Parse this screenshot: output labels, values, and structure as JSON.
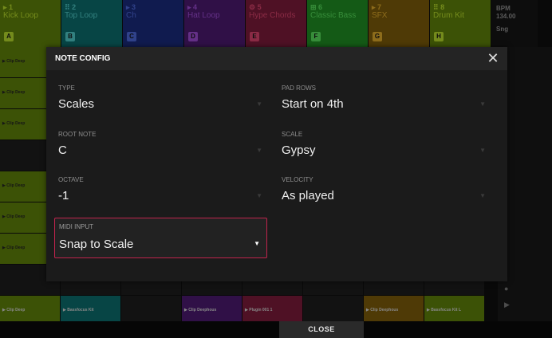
{
  "tracks": [
    {
      "num": "▸ 1",
      "name": "Kick Loop",
      "badge": "A",
      "bg": "#5d7f0a",
      "fg": "#b3d62b"
    },
    {
      "num": "⠿ 2",
      "name": "Top Loop",
      "badge": "B",
      "bg": "#0b6b6a",
      "fg": "#4ec5c3"
    },
    {
      "num": "▸ 3",
      "name": "Ch",
      "badge": "C",
      "bg": "#1a2a7a",
      "fg": "#4b66d4"
    },
    {
      "num": "▸ 4",
      "name": "Hat Loop",
      "badge": "D",
      "bg": "#4a1a6e",
      "fg": "#9a4ad0"
    },
    {
      "num": "⚙ 5",
      "name": "Hype Chords",
      "badge": "E",
      "bg": "#7a1b3a",
      "fg": "#d4436a"
    },
    {
      "num": "⊞ 6",
      "name": "Classic Bass",
      "badge": "F",
      "bg": "#1f8a22",
      "fg": "#55d95a"
    },
    {
      "num": "▸ 7",
      "name": "SFX",
      "badge": "G",
      "bg": "#7a5a0a",
      "fg": "#d9a62a"
    },
    {
      "num": "⠿ 8",
      "name": "Drum Kit",
      "badge": "H",
      "bg": "#5d7f0a",
      "fg": "#b3d62b"
    }
  ],
  "bpm": {
    "label": "BPM",
    "value": "134.00",
    "extra": "Sng"
  },
  "clip_label": "▶ Clip Deep",
  "bottom_clips": [
    "▶ Clip Deep",
    "▶ Bassfocus Kit",
    "",
    "▶ Clip Deephous",
    "▶ Plugin 001 1",
    "",
    "▶ Clip Deephous",
    "▶ Bassfocus Kit L"
  ],
  "modal": {
    "title": "NOTE CONFIG",
    "close_icon": "✕",
    "fields": {
      "type": {
        "label": "TYPE",
        "value": "Scales"
      },
      "pad_rows": {
        "label": "PAD ROWS",
        "value": "Start on 4th"
      },
      "root_note": {
        "label": "ROOT NOTE",
        "value": "C"
      },
      "scale": {
        "label": "SCALE",
        "value": "Gypsy"
      },
      "octave": {
        "label": "OCTAVE",
        "value": "-1"
      },
      "velocity": {
        "label": "VELOCITY",
        "value": "As played"
      },
      "midi_input": {
        "label": "MIDI INPUT",
        "value": "Snap to Scale"
      }
    }
  },
  "close_button": "CLOSE",
  "colors": {
    "accent_focus": "#c1244d"
  }
}
